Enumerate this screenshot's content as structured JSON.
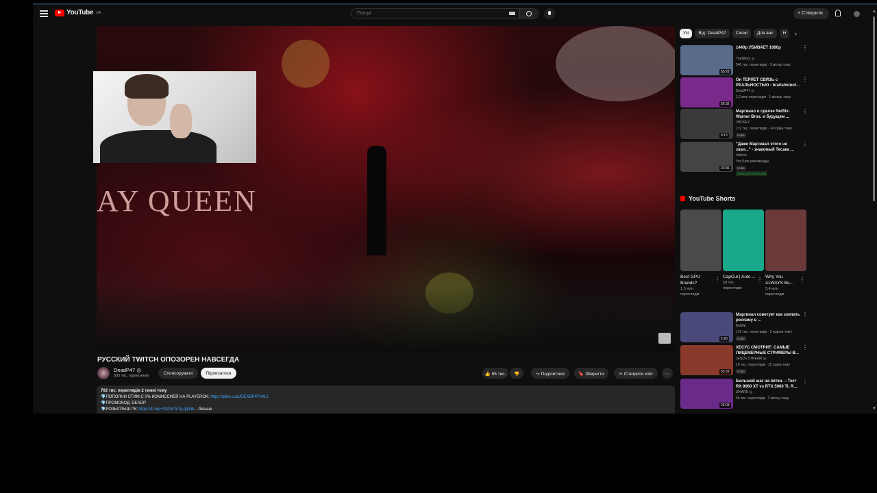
{
  "header": {
    "logo_text": "YouTube",
    "logo_country": "UA",
    "search_placeholder": "Пошук",
    "create_label": "+ Створити"
  },
  "video": {
    "overlay_text": "AY QUEEN",
    "title": "РУССКИЙ TWITCH ОПОЗОРЕН НАВСЕГДА",
    "channel": "DeadP47 ◎",
    "subscribers": "503 тис. підписників",
    "sponsor_label": "Спонсорувати",
    "subscribe_label": "Підписатися",
    "likes": "👍 55 тис.",
    "dislike": "👎",
    "share": "↪ Поділитися",
    "save": "🔖 Зберегти",
    "clip": "✂ Створити кліп",
    "more": "⋯"
  },
  "description": {
    "meta": "702 тис. переглядів  2 тижні тому",
    "line1": "💎ПОПОЛНИ СТИМ С 0% КОМИССИЕЙ НА PLAYEROK: ",
    "line1_link": "https://pink.cu/p/DEADP470412",
    "line2": "💎ПРОМОКОД: DEADP",
    "line3": "💎РОЗЫГРЫШ ПК: ",
    "line3_link": "https://t.me/+3S2MTeTy-qlyNb",
    "more": "...більше"
  },
  "chips": [
    "Усі",
    "Від: DeadP47",
    "Схожі",
    "Для вас",
    "Н"
  ],
  "recs_top": [
    {
      "title": "1440p УБИВАЕТ 1080p",
      "channel": "TheDRZJ ◎",
      "meta": "546 тис. переглядів · 3 місяці тому",
      "duration": "55:28",
      "color": "#5a6a8a"
    },
    {
      "title": "Он ТЕРЯЕТ СВЯЗЬ с РЕАЛЬНОСТЬЮ - bratishkinof...",
      "channel": "DeadP47 ◎",
      "meta": "1,2 млн переглядів · 1 місяць тому",
      "duration": "26:32",
      "color": "#7a2a8a"
    },
    {
      "title": "Маргинал о сделке Netflix-Warner Bros. и будущем ...",
      "channel": "JMCKEY",
      "meta": "172 тис. переглядів · 14 годин тому",
      "duration": "8:13",
      "color": "#3a3a3a",
      "badge": "Нове"
    },
    {
      "title": "\"Даже Маргинал этого не знал...\" - знакомый Тесака ...",
      "channel": "Jiblunn",
      "meta": "21 годину тому",
      "duration": "23:36",
      "color": "#444",
      "badge": "Нове",
      "extra": "YouTube рекомендує",
      "sponsor": "Лише для спонсорів"
    }
  ],
  "shorts_heading": "YouTube Shorts",
  "shorts": [
    {
      "title": "Best GPU Brands?",
      "views": "1,3 млн переглядів",
      "color": "#4a4a4a"
    },
    {
      "title": "CapCut | Auto ...",
      "views": "50 тис. переглядів",
      "color": "#1aa88a"
    },
    {
      "title": "Why You ALWAYS Bu...",
      "views": "5,4 млн переглядів",
      "color": "#6a3a3a"
    }
  ],
  "recs_bottom": [
    {
      "title": "Маргинал советует как скипать рекламу в ...",
      "channel": "Бейби",
      "meta": "176 тис. переглядів · 2 години тому",
      "duration": "2:26",
      "color": "#4a4a7a",
      "badge": "Нове"
    },
    {
      "title": "ХЕСУС СМОТРИТ: САМЫЕ ЛИЦЕМЕРНЫЕ СТРИМЕРЫ В...",
      "channel": "JESUS STREAM ◎",
      "meta": "10 тис. переглядів · 15 годин тому",
      "duration": "53:33",
      "color": "#8a3a2a",
      "badge": "Нове"
    },
    {
      "title": "Большой шаг на пятки. – Тест RX 9060 XT vs RTX 5060 Ti, R...",
      "channel": "iZHARD ◎",
      "meta": "56 тис. переглядів · 2 місяці тому",
      "duration": "23:03",
      "color": "#6a2a8a"
    }
  ]
}
